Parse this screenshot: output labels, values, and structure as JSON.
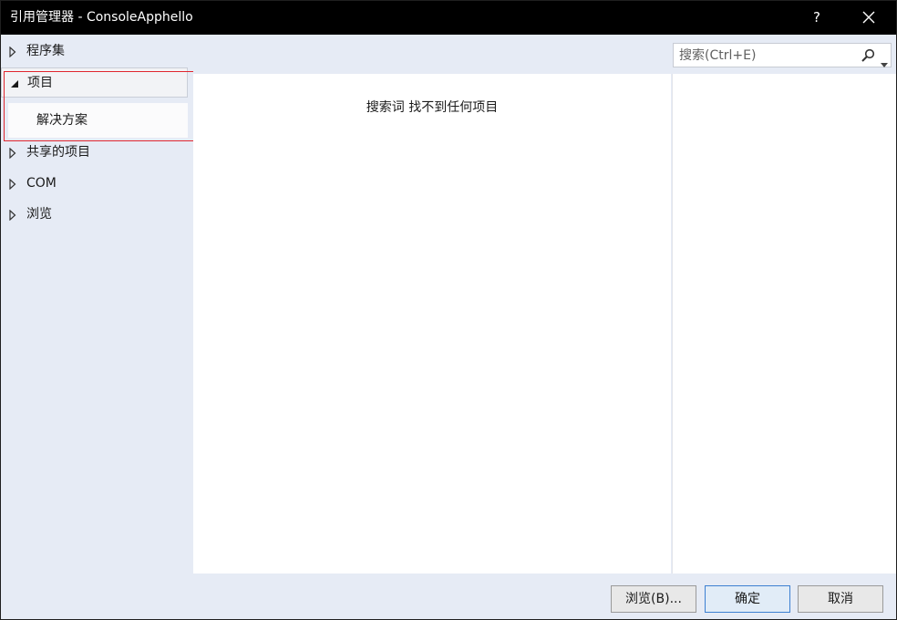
{
  "window": {
    "title": "引用管理器 - ConsoleApphello",
    "help_label": "?",
    "close_label": "✕"
  },
  "sidebar": {
    "items": [
      {
        "label": "程序集",
        "expanded": false
      },
      {
        "label": "项目",
        "expanded": true,
        "selected": true
      },
      {
        "label": "共享的项目",
        "expanded": false
      },
      {
        "label": "COM",
        "expanded": false
      },
      {
        "label": "浏览",
        "expanded": false
      }
    ],
    "subitems": [
      {
        "label": "解决方案"
      }
    ]
  },
  "search": {
    "placeholder": "搜索(Ctrl+E)",
    "value": ""
  },
  "content": {
    "empty_message": "搜索词  找不到任何项目"
  },
  "footer": {
    "browse_label": "浏览(B)...",
    "ok_label": "确定",
    "cancel_label": "取消"
  },
  "colors": {
    "titlebar": "#000000",
    "panel_bg": "#e6ebf5",
    "highlight": "#e0262f",
    "primary_border": "#3c7fd1"
  }
}
